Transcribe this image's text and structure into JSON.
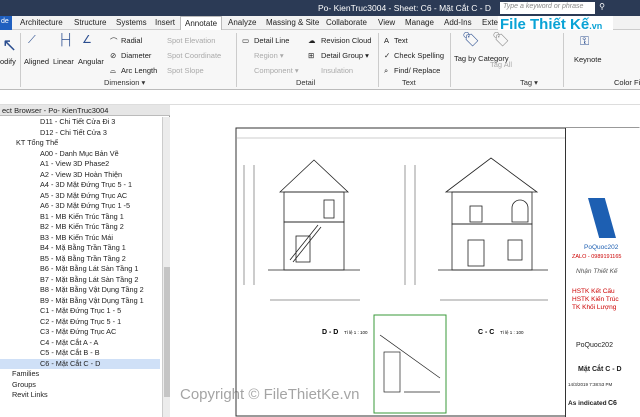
{
  "window": {
    "title": "Po- KienTruc3004 - Sheet: C6 - Mặt Cắt C - D",
    "search_placeholder": "Type a keyword or phrase"
  },
  "menu": {
    "file": "de",
    "tabs": [
      "Architecture",
      "Structure",
      "Systems",
      "Insert",
      "Annotate",
      "Analyze",
      "Massing & Site",
      "Collaborate",
      "View",
      "Manage",
      "Add-Ins",
      "Exten"
    ],
    "active": "Annotate"
  },
  "logo": {
    "big": "File Thiết Kế",
    "small": ".vn"
  },
  "ribbon": {
    "modify": "odify",
    "dimension": {
      "aligned": "Aligned",
      "linear": "Linear",
      "angular": "Angular",
      "radial": "Radial",
      "diameter": "Diameter",
      "arc_length": "Arc Length",
      "spot_elevation": "Spot Elevation",
      "spot_coordinate": "Spot Coordinate",
      "spot_slope": "Spot Slope",
      "group_label": "Dimension ▾"
    },
    "detail": {
      "detail_line": "Detail Line",
      "region": "Region ▾",
      "component": "Component ▾",
      "revision_cloud": "Revision Cloud",
      "detail_group": "Detail Group ▾",
      "insulation": "Insulation",
      "group_label": "Detail"
    },
    "text": {
      "text": "Text",
      "check_spelling": "Check Spelling",
      "find_replace": "Find/ Replace",
      "group_label": "Text"
    },
    "tag": {
      "tag_by_category": "Tag by Category",
      "tag_all": "Tag All",
      "group_label": "Tag ▾"
    },
    "keynote": "Keynote",
    "color_fill": "Color Fil"
  },
  "browser": {
    "title": "ect Browser - Po- KienTruc3004",
    "nodes": [
      {
        "t": "D11 - Chi Tiết Cửa Đi 3",
        "ind": 40
      },
      {
        "t": "D12 - Chi Tiết Cửa 3",
        "ind": 40
      },
      {
        "t": "KT Tổng Thể",
        "ind": 16
      },
      {
        "t": "A00 - Danh Mục Bản Vẽ",
        "ind": 40
      },
      {
        "t": "A1 - View 3D Phase2",
        "ind": 40
      },
      {
        "t": "A2 - View 3D Hoàn Thiện",
        "ind": 40
      },
      {
        "t": "A4 - 3D Mặt Đứng Trục 5 - 1",
        "ind": 40
      },
      {
        "t": "A5 - 3D Mặt Đứng Trục AC",
        "ind": 40
      },
      {
        "t": "A6 - 3D Mặt Đứng Trục 1 -5",
        "ind": 40
      },
      {
        "t": "B1 - MB Kiến Trúc Tầng 1",
        "ind": 40
      },
      {
        "t": "B2 - MB Kiến Trúc Tầng 2",
        "ind": 40
      },
      {
        "t": "B3 - MB Kiến Trúc Mái",
        "ind": 40
      },
      {
        "t": "B4 - Mặ Bằng Trần Tầng 1",
        "ind": 40
      },
      {
        "t": "B5 - Mặ Bằng Trần Tầng 2",
        "ind": 40
      },
      {
        "t": "B6 - Mặt Bằng Lát Sàn Tầng 1",
        "ind": 40
      },
      {
        "t": "B7 - Mặt Bằng Lát Sàn Tầng 2",
        "ind": 40
      },
      {
        "t": "B8 - Mặt Bằng Vật Dụng Tầng 2",
        "ind": 40
      },
      {
        "t": "B9 - Mặt Bằng Vật Dụng Tầng 1",
        "ind": 40
      },
      {
        "t": "C1 - Mặt Đứng Trục 1 - 5",
        "ind": 40
      },
      {
        "t": "C2 - Mặt Đứng Trục 5 - 1",
        "ind": 40
      },
      {
        "t": "C3 - Mặt Đứng Trục AC",
        "ind": 40
      },
      {
        "t": "C4 - Mặt Cắt A - A",
        "ind": 40
      },
      {
        "t": "C5 - Mặt Cắt B - B",
        "ind": 40
      },
      {
        "t": "C6 - Mặt Cắt C - D",
        "ind": 40,
        "sel": true
      },
      {
        "t": "Families",
        "ind": 12
      },
      {
        "t": "Groups",
        "ind": 12
      },
      {
        "t": "Revit Links",
        "ind": 12
      }
    ]
  },
  "sheet": {
    "view1": "D - D",
    "view2": "C - C",
    "scale": "Tỉ lệ 1 : 100",
    "tb": {
      "brand": "PoQuoc202",
      "phone": "ZALO - 0989191165",
      "sign": "Nhận Thiết Kế",
      "s1": "HSTK Kết Cấu",
      "s2": "HSTK Kiến Trúc",
      "s3": "TK Khối Lượng",
      "owner": "PoQuoc202",
      "dwg": "Mặt Cắt C - D",
      "date": "14/3/2019 7:38:53 PM",
      "scale": "As indicated",
      "num": "C6"
    }
  },
  "watermark": "Copyright © FileThietKe.vn"
}
